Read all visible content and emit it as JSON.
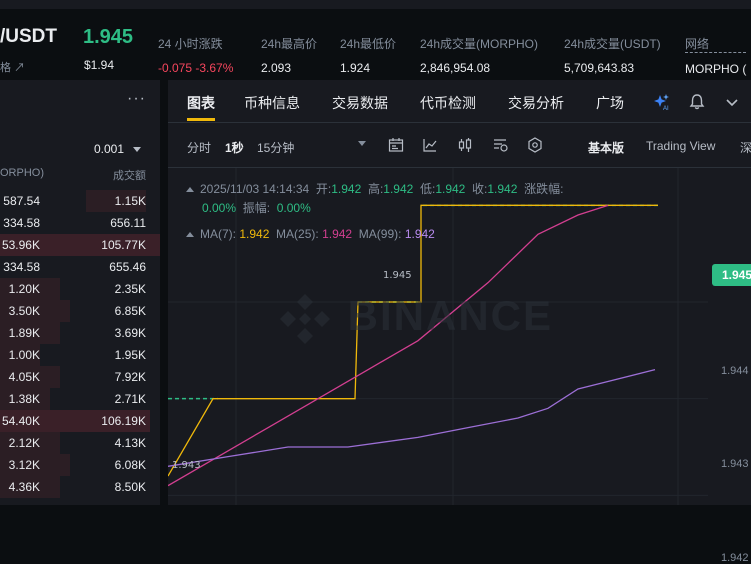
{
  "ticker": {
    "pair": "/USDT",
    "pair_sub": "格 ↗",
    "last_price": "1.945",
    "last_price_usd": "$1.94",
    "stats": [
      {
        "label": "24 小时涨跌",
        "value": "-0.075 -3.67%",
        "negative": true
      },
      {
        "label": "24h最高价",
        "value": "2.093"
      },
      {
        "label": "24h最低价",
        "value": "1.924"
      },
      {
        "label": "24h成交量(MORPHO)",
        "value": "2,846,954.08"
      },
      {
        "label": "24h成交量(USDT)",
        "value": "5,709,643.83"
      },
      {
        "label": "网络",
        "value": "MORPHO ("
      }
    ]
  },
  "orderbook": {
    "menu_icon": "more-dots-icon",
    "precision": "0.001",
    "col1_header": "ORPHO)",
    "col2_header": "成交额",
    "rows": [
      {
        "amount": "587.54",
        "total": "1.15K"
      },
      {
        "amount": "334.58",
        "total": "656.11"
      },
      {
        "amount": "53.96K",
        "total": "105.77K"
      },
      {
        "amount": "334.58",
        "total": "655.46"
      },
      {
        "amount": "1.20K",
        "total": "2.35K"
      },
      {
        "amount": "3.50K",
        "total": "6.85K"
      },
      {
        "amount": "1.89K",
        "total": "3.69K"
      },
      {
        "amount": "1.00K",
        "total": "1.95K"
      },
      {
        "amount": "4.05K",
        "total": "7.92K"
      },
      {
        "amount": "1.38K",
        "total": "2.71K"
      },
      {
        "amount": "54.40K",
        "total": "106.19K"
      },
      {
        "amount": "2.12K",
        "total": "4.13K"
      },
      {
        "amount": "3.12K",
        "total": "6.08K"
      },
      {
        "amount": "4.36K",
        "total": "8.50K"
      }
    ]
  },
  "tabs": [
    "图表",
    "币种信息",
    "交易数据",
    "代币检测",
    "交易分析",
    "广场"
  ],
  "toolbar": {
    "intervals": [
      "分时",
      "1秒",
      "15分钟"
    ],
    "active_interval": "1秒",
    "icons": [
      "indicator-icon",
      "line-tool-icon",
      "candle-type-icon",
      "template-icon",
      "settings-icon"
    ],
    "views": [
      "基本版",
      "Trading View",
      "深"
    ],
    "active_view": "基本版"
  },
  "chart_info": {
    "datetime": "2025/11/03 14:14:34",
    "open_label": "开:",
    "open": "1.942",
    "high_label": "高:",
    "high": "1.942",
    "low_label": "低:",
    "low": "1.942",
    "close_label": "收:",
    "close": "1.942",
    "change_label": "涨跌幅:",
    "change": "0.00%",
    "amplitude_label": "振幅:",
    "amplitude": "0.00%",
    "ma7_label": "MA(7):",
    "ma7": "1.942",
    "ma25_label": "MA(25):",
    "ma25": "1.942",
    "ma99_label": "MA(99):",
    "ma99": "1.942"
  },
  "price_tag": "1.945",
  "watermark": "BINANCE",
  "colors": {
    "up": "#2ebd85",
    "down": "#f6465d",
    "ma7": "#f0b90b",
    "ma25": "#d23f90",
    "ma99": "#9c6fd6"
  },
  "chart_data": {
    "type": "line",
    "y_axis_labels": [
      "1.944",
      "1.943",
      "1.942"
    ],
    "ylim": [
      1.9419,
      1.9452
    ],
    "inline_labels": [
      "1.945",
      "1.943"
    ],
    "series": [
      {
        "name": "MA(7)",
        "values": [
          1.9422,
          1.943,
          1.943,
          1.943,
          1.943,
          1.944,
          1.944,
          1.945,
          1.945,
          1.945,
          1.945,
          1.945
        ]
      },
      {
        "name": "MA(25)",
        "values": [
          1.9421,
          1.9424,
          1.9427,
          1.943,
          1.9433,
          1.9436,
          1.9442,
          1.9447,
          1.9449,
          1.945
        ]
      },
      {
        "name": "MA(99)",
        "values": [
          1.9423,
          1.9424,
          1.9425,
          1.9425,
          1.9426,
          1.9427,
          1.9428,
          1.9429,
          1.9431,
          1.9433
        ]
      }
    ],
    "dashed_levels": [
      1.943,
      1.944,
      1.945
    ]
  }
}
